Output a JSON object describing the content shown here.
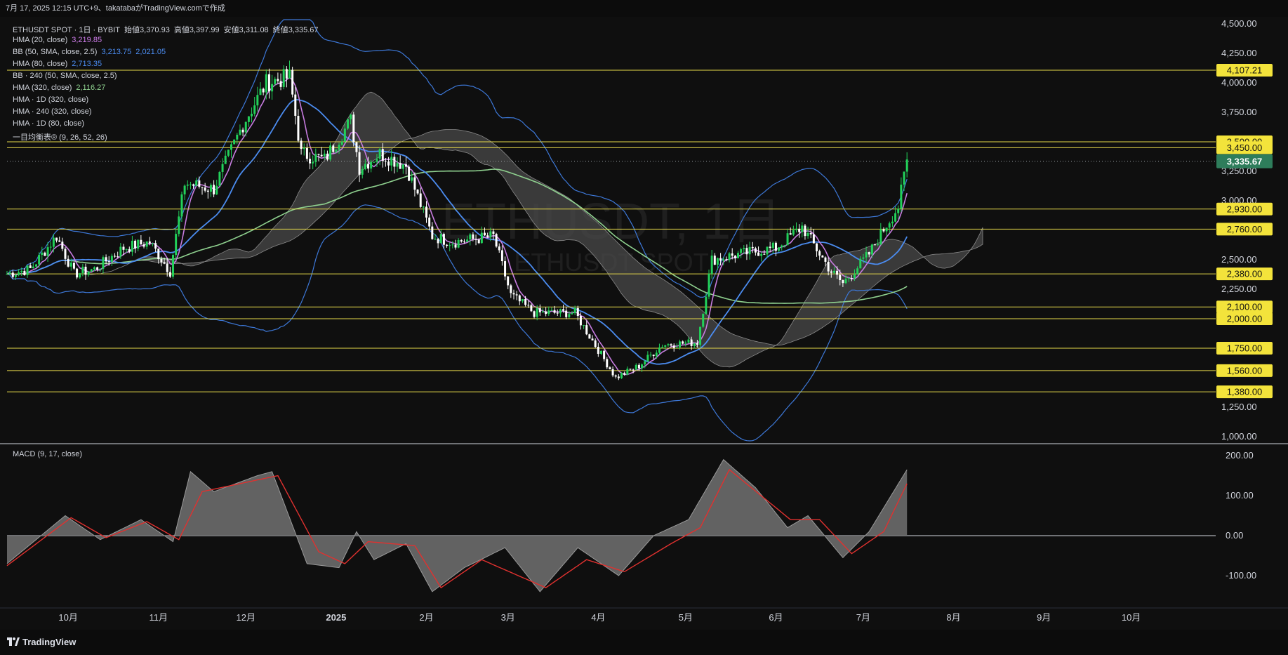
{
  "header": {
    "caption": "7月 17, 2025 12:15 UTC+9、takatabaがTradingView.comで作成"
  },
  "legend": {
    "symbol_line": "ETHUSDT SPOT · 1日 · BYBIT",
    "ohlc": [
      {
        "label": "始値",
        "value": "3,370.93"
      },
      {
        "label": "高値",
        "value": "3,397.99"
      },
      {
        "label": "安値",
        "value": "3,311.08"
      },
      {
        "label": "終値",
        "value": "3,335.67"
      }
    ],
    "indicators": [
      {
        "name": "HMA (20, close)",
        "values": [
          "3,219.85"
        ],
        "colors": [
          "#d37ff0"
        ]
      },
      {
        "name": "BB (50, SMA, close, 2.5)",
        "values": [
          "3,213.75",
          "2,021.05"
        ],
        "colors": [
          "#4b8cf0",
          "#4b8cf0"
        ]
      },
      {
        "name": "HMA (80, close)",
        "values": [
          "2,713.35"
        ],
        "colors": [
          "#4b8cf0"
        ]
      },
      {
        "name": "BB · 240 (50, SMA, close, 2.5)",
        "values": [],
        "colors": []
      },
      {
        "name": "HMA (320, close)",
        "values": [
          "2,116.27"
        ],
        "colors": [
          "#8fd18f"
        ]
      },
      {
        "name": "HMA · 1D (320, close)",
        "values": [],
        "colors": []
      },
      {
        "name": "HMA · 240 (320, close)",
        "values": [],
        "colors": []
      },
      {
        "name": "HMA · 1D (80, close)",
        "values": [],
        "colors": []
      },
      {
        "name": "一目均衡表® (9, 26, 52, 26)",
        "values": [],
        "colors": []
      }
    ]
  },
  "watermark": {
    "main": "ETHUSDT, 1日",
    "sub": "ETHUSDT SPOT"
  },
  "macd": {
    "label": "MACD (9, 17, close)"
  },
  "footer": {
    "brand": "TradingView"
  },
  "colors": {
    "background": "#0f0f0f",
    "up": "#22d15a",
    "down": "#ffffff",
    "level_line": "#e5d84a",
    "level_badge": "#f3e33b",
    "price_badge": "#2e7d5b",
    "bb": "#3d78d8",
    "hma20": "#c77ce0",
    "hma80": "#4b8cf0",
    "hma320": "#8fd18f",
    "cloud": "#4a4a4a",
    "macd_hist": "#6b6b6b",
    "macd_signal": "#e0312f"
  },
  "chart_data": [
    {
      "type": "candlestick",
      "title": "ETHUSDT SPOT · 1日 · BYBIT",
      "x_ticks": [
        "10月",
        "11月",
        "12月",
        "2025",
        "2月",
        "3月",
        "4月",
        "5月",
        "6月",
        "7月",
        "8月",
        "9月",
        "10月"
      ],
      "y_ticks": [
        "4,500.00",
        "4,250.00",
        "4,000.00",
        "3,750.00",
        "3,500.00",
        "3,250.00",
        "3,000.00",
        "2,750.00",
        "2,500.00",
        "2,250.00",
        "2,000.00",
        "1,750.00",
        "1,500.00",
        "1,250.00",
        "1,000.00"
      ],
      "ylim": [
        1000,
        4500
      ],
      "horizontal_levels": [
        "4,107.21",
        "3,500.00",
        "3,450.00",
        "2,930.00",
        "2,760.00",
        "2,380.00",
        "2,100.00",
        "2,000.00",
        "1,750.00",
        "1,560.00",
        "1,380.00"
      ],
      "last_price": "3,335.67",
      "price_path": [
        [
          "2024-09-10",
          2380
        ],
        [
          "2024-09-18",
          2420
        ],
        [
          "2024-09-27",
          2700
        ],
        [
          "2024-10-03",
          2380
        ],
        [
          "2024-10-10",
          2420
        ],
        [
          "2024-10-20",
          2600
        ],
        [
          "2024-10-29",
          2650
        ],
        [
          "2024-11-05",
          2400
        ],
        [
          "2024-11-10",
          3150
        ],
        [
          "2024-11-20",
          3100
        ],
        [
          "2024-11-30",
          3650
        ],
        [
          "2024-12-08",
          4000
        ],
        [
          "2024-12-16",
          4050
        ],
        [
          "2024-12-20",
          3400
        ],
        [
          "2024-12-28",
          3350
        ],
        [
          "2025-01-06",
          3680
        ],
        [
          "2025-01-09",
          3280
        ],
        [
          "2025-01-16",
          3400
        ],
        [
          "2025-01-25",
          3300
        ],
        [
          "2025-02-03",
          2700
        ],
        [
          "2025-02-10",
          2650
        ],
        [
          "2025-02-24",
          2700
        ],
        [
          "2025-03-02",
          2200
        ],
        [
          "2025-03-10",
          2050
        ],
        [
          "2025-03-24",
          2050
        ],
        [
          "2025-04-07",
          1500
        ],
        [
          "2025-04-15",
          1600
        ],
        [
          "2025-04-23",
          1780
        ],
        [
          "2025-05-05",
          1800
        ],
        [
          "2025-05-10",
          2500
        ],
        [
          "2025-05-20",
          2550
        ],
        [
          "2025-06-01",
          2600
        ],
        [
          "2025-06-10",
          2780
        ],
        [
          "2025-06-20",
          2400
        ],
        [
          "2025-06-24",
          2300
        ],
        [
          "2025-07-03",
          2550
        ],
        [
          "2025-07-09",
          2800
        ],
        [
          "2025-07-13",
          2950
        ],
        [
          "2025-07-16",
          3335
        ]
      ]
    },
    {
      "type": "area",
      "title": "MACD (9, 17, close)",
      "y_ticks": [
        "200.00",
        "100.00",
        "0.00",
        "-100.00"
      ],
      "ylim": [
        -150,
        215
      ],
      "macd_path": [
        [
          "2024-09-10",
          -70
        ],
        [
          "2024-09-30",
          50
        ],
        [
          "2024-10-12",
          -10
        ],
        [
          "2024-10-26",
          40
        ],
        [
          "2024-11-06",
          -15
        ],
        [
          "2024-11-12",
          160
        ],
        [
          "2024-11-20",
          110
        ],
        [
          "2024-12-05",
          150
        ],
        [
          "2024-12-10",
          160
        ],
        [
          "2024-12-22",
          -70
        ],
        [
          "2025-01-02",
          -80
        ],
        [
          "2025-01-08",
          10
        ],
        [
          "2025-01-14",
          -60
        ],
        [
          "2025-01-25",
          -20
        ],
        [
          "2025-02-03",
          -140
        ],
        [
          "2025-02-14",
          -80
        ],
        [
          "2025-02-28",
          -30
        ],
        [
          "2025-03-12",
          -140
        ],
        [
          "2025-03-25",
          -30
        ],
        [
          "2025-04-08",
          -100
        ],
        [
          "2025-04-20",
          0
        ],
        [
          "2025-05-02",
          40
        ],
        [
          "2025-05-14",
          190
        ],
        [
          "2025-05-25",
          120
        ],
        [
          "2025-06-05",
          20
        ],
        [
          "2025-06-12",
          50
        ],
        [
          "2025-06-24",
          -55
        ],
        [
          "2025-07-03",
          10
        ],
        [
          "2025-07-16",
          165
        ]
      ],
      "signal_path": [
        [
          "2024-09-10",
          -75
        ],
        [
          "2024-10-02",
          45
        ],
        [
          "2024-10-14",
          -5
        ],
        [
          "2024-10-28",
          35
        ],
        [
          "2024-11-08",
          -10
        ],
        [
          "2024-11-16",
          110
        ],
        [
          "2024-12-12",
          150
        ],
        [
          "2024-12-26",
          -40
        ],
        [
          "2025-01-04",
          -70
        ],
        [
          "2025-01-12",
          -15
        ],
        [
          "2025-01-28",
          -25
        ],
        [
          "2025-02-06",
          -130
        ],
        [
          "2025-02-20",
          -60
        ],
        [
          "2025-03-14",
          -130
        ],
        [
          "2025-03-28",
          -60
        ],
        [
          "2025-04-10",
          -90
        ],
        [
          "2025-04-26",
          -20
        ],
        [
          "2025-05-06",
          20
        ],
        [
          "2025-05-16",
          165
        ],
        [
          "2025-06-06",
          40
        ],
        [
          "2025-06-16",
          40
        ],
        [
          "2025-06-27",
          -45
        ],
        [
          "2025-07-08",
          10
        ],
        [
          "2025-07-16",
          130
        ]
      ]
    }
  ]
}
